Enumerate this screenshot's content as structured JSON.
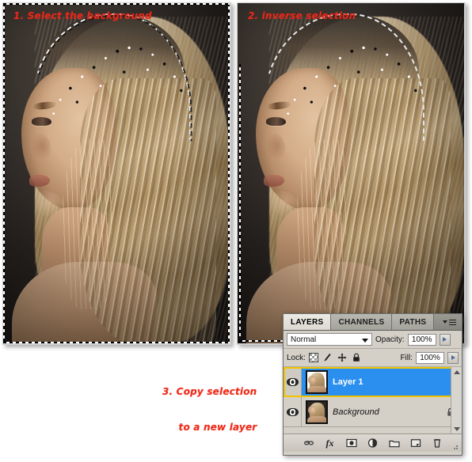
{
  "annotations": {
    "step1": "1. Select the background",
    "step2": "2. inverse selection",
    "step3_line1": "3. Copy selection",
    "step3_line2": "to a new layer"
  },
  "layers_panel": {
    "tabs": [
      {
        "label": "LAYERS",
        "active": true
      },
      {
        "label": "CHANNELS",
        "active": false
      },
      {
        "label": "PATHS",
        "active": false
      }
    ],
    "panel_menu_icon": "panel-menu-icon",
    "blend_mode": "Normal",
    "opacity": {
      "label": "Opacity:",
      "value": "100%"
    },
    "fill": {
      "label": "Fill:",
      "value": "100%"
    },
    "lock": {
      "label": "Lock:",
      "icons": [
        "lock-transparent-pixels-icon",
        "lock-image-pixels-icon",
        "lock-position-icon",
        "lock-all-icon"
      ]
    },
    "layers": [
      {
        "name": "Layer 1",
        "visible": true,
        "selected": true,
        "locked": false,
        "thumbnail": "layer1-thumbnail"
      },
      {
        "name": "Background",
        "visible": true,
        "selected": false,
        "locked": true,
        "thumbnail": "background-thumbnail"
      }
    ],
    "bottom_buttons": [
      "link-layers-icon",
      "layer-style-fx-icon",
      "add-layer-mask-icon",
      "new-adjustment-layer-icon",
      "new-group-icon",
      "new-layer-icon",
      "delete-layer-icon"
    ],
    "colors": {
      "selection_blue": "#2a8fee",
      "selection_outline": "#f0c400",
      "panel_face": "#d4d0c8",
      "annotation_red": "#e8271a"
    }
  }
}
